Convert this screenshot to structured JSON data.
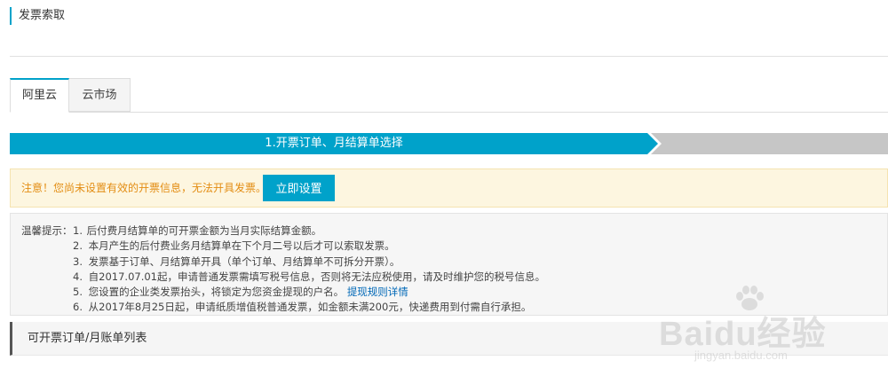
{
  "page": {
    "title": "发票索取"
  },
  "tabs": [
    {
      "label": "阿里云",
      "active": true
    },
    {
      "label": "云市场",
      "active": false
    }
  ],
  "steps": [
    {
      "label": "1.开票订单、月结算单选择",
      "state": "current"
    },
    {
      "label": "",
      "state": "pending"
    }
  ],
  "notice": {
    "text": "注意！您尚未设置有效的开票信息，无法开具发票。",
    "button_label": "立即设置"
  },
  "tips": {
    "label": "温馨提示：",
    "items": [
      {
        "num": "1.",
        "text": "后付费月结算单的可开票金额为当月实际结算金额。"
      },
      {
        "num": "2.",
        "text": "本月产生的后付费业务月结算单在下个月二号以后才可以索取发票。"
      },
      {
        "num": "3.",
        "text": "发票基于订单、月结算单开具（单个订单、月结算单不可拆分开票）。"
      },
      {
        "num": "4.",
        "text": "自2017.07.01起，申请普通发票需填写税号信息，否则将无法应税使用，请及时维护您的税号信息。"
      },
      {
        "num": "5.",
        "text": "您设置的企业类发票抬头，将锁定为您资金提现的户名。",
        "link": "提现规则详情"
      },
      {
        "num": "6.",
        "text": "从2017年8月25日起，申请纸质增值税普通发票，如金额未满200元，快递费用到付需自行承担。"
      }
    ]
  },
  "list_section": {
    "title": "可开票订单/月账单列表"
  },
  "watermark": {
    "brand": "Baidu经验",
    "url": "jingyan.baidu.com"
  },
  "colors": {
    "accent": "#00a2ca",
    "warning_text": "#e38d13",
    "link": "#0068b7",
    "step_pending": "#c6c6c6"
  }
}
